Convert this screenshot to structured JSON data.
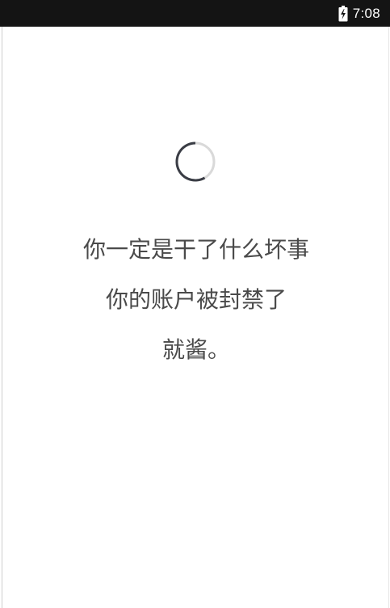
{
  "status_bar": {
    "time": "7:08",
    "battery_icon": "battery-charging-icon"
  },
  "loading": {
    "spinner_icon": "loading-spinner-icon"
  },
  "message": {
    "line1": "你一定是干了什么坏事",
    "line2": "你的账户被封禁了",
    "line3": "就酱。"
  },
  "colors": {
    "status_bar_bg": "#141414",
    "text": "#4a4a4a",
    "spinner_dark": "#3a3d45",
    "spinner_light": "#d9d9d9"
  }
}
